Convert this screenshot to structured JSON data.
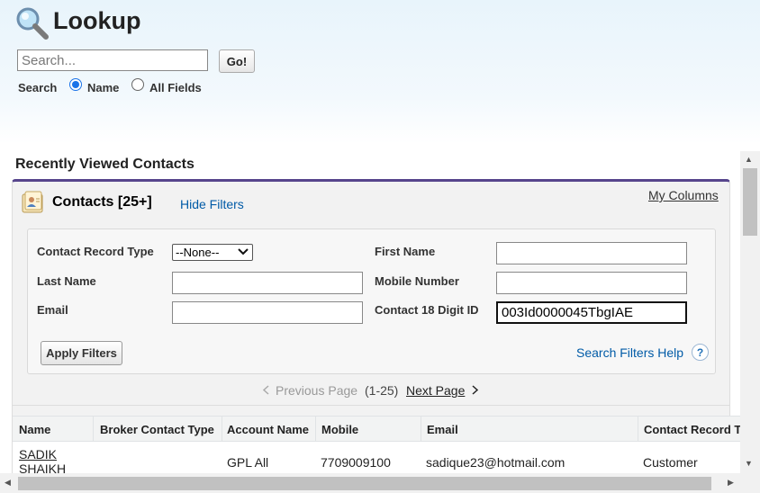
{
  "header": {
    "title": "Lookup",
    "icon": "magnifier-icon"
  },
  "search": {
    "placeholder": "Search...",
    "value": "",
    "go_label": "Go!",
    "scope_label": "Search",
    "options": [
      {
        "label": "Name",
        "checked": true
      },
      {
        "label": "All Fields",
        "checked": false
      }
    ]
  },
  "section": {
    "title": "Recently Viewed Contacts"
  },
  "list": {
    "title": "Contacts [25+]",
    "hide_filters": "Hide Filters",
    "my_columns": "My Columns"
  },
  "filters": {
    "contact_record_type": {
      "label": "Contact Record Type",
      "value": "--None--"
    },
    "first_name": {
      "label": "First Name",
      "value": ""
    },
    "last_name": {
      "label": "Last Name",
      "value": ""
    },
    "mobile_number": {
      "label": "Mobile Number",
      "value": ""
    },
    "email": {
      "label": "Email",
      "value": ""
    },
    "contact_18_digit_id": {
      "label": "Contact 18 Digit ID",
      "value": "003Id0000045TbgIAE"
    },
    "apply_label": "Apply Filters",
    "help_label": "Search Filters Help",
    "help_icon": "?"
  },
  "pager": {
    "previous": "Previous Page",
    "range": "(1-25)",
    "next": "Next Page"
  },
  "table": {
    "columns": [
      "Name",
      "Broker Contact Type",
      "Account Name",
      "Mobile",
      "Email",
      "Contact Record T"
    ],
    "rows": [
      {
        "name_line1": "SADIK",
        "name_line2": "SHAIKH",
        "broker_contact_type": "",
        "account_name": "GPL All",
        "mobile": "7709009100",
        "email": "sadique23@hotmail.com",
        "contact_record_type": "Customer"
      }
    ]
  },
  "colors": {
    "accent": "#56458c",
    "link": "#015ba7"
  }
}
